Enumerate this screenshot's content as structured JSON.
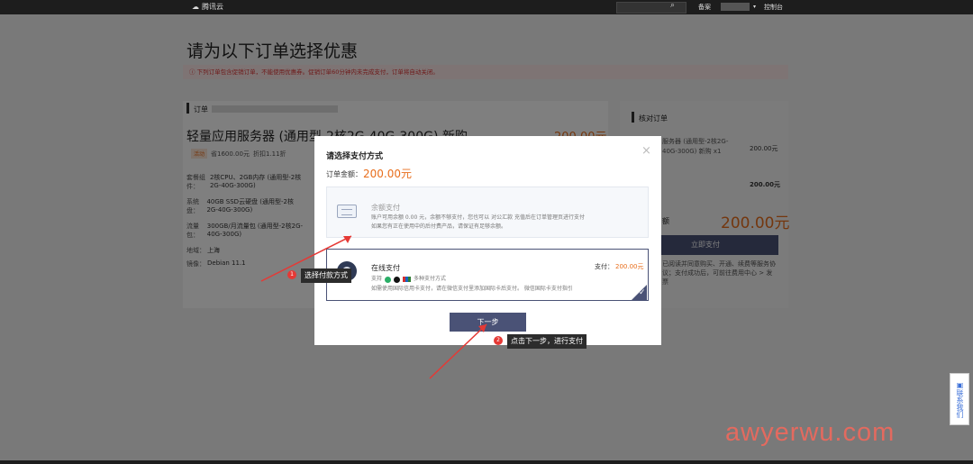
{
  "topbar": {
    "logo": "腾讯云",
    "nav_beian": "备案",
    "nav_console": "控制台"
  },
  "page": {
    "title": "请为以下订单选择优惠",
    "notice": "下列订单包含促销订单，不能使用优惠券。促销订单60分钟内未完成支付，订单将自动关闭。",
    "order_label": "订单",
    "product_name": "轻量应用服务器 (通用型-2核2G-40G-300G) 新购",
    "product_price": "200.00元",
    "tag_activity": "活动",
    "original_price": "省1600.00元",
    "discount": "折扣1.11折",
    "specs": [
      {
        "label": "套餐组件：",
        "value": "2核CPU、2GB内存 (通用型-2核2G-40G-300G)"
      },
      {
        "label": "系统盘：",
        "value": "40GB SSD云硬盘 (通用型-2核2G-40G-300G)"
      },
      {
        "label": "流量包：",
        "value": "300GB/月流量包 (通用型-2核2G-40G-300G)"
      },
      {
        "label": "地域：",
        "value": "上海"
      },
      {
        "label": "镜像：",
        "value": "Debian 11.1"
      }
    ],
    "right_title": "核对订单",
    "right_item_name": "服务器 (通用型-2核2G-40G-300G) 新购 x1",
    "right_item_price": "200.00元",
    "right_subtotal": "200.00元",
    "right_total_label": "额",
    "right_total": "200.00元",
    "buy_button": "立即支付",
    "right_note": "已阅读并同意购买、开通、续费等服务协议；支付成功后，可前往费用中心 > 发票"
  },
  "modal": {
    "title": "请选择支付方式",
    "amount_label": "订单金额：",
    "amount_value": "200.00元",
    "balance_title": "余额支付",
    "balance_desc1": "账户可用余额 0.00 元，余额不够支付，您也可以 对公汇款 充值后在订单管理页进行支付",
    "balance_desc2": "如果您有正在使用中的后付费产品，请保证有足够余额。",
    "online_title": "在线支付",
    "online_pay_label": "支付：",
    "online_pay_value": "200.00元",
    "online_support": "支持",
    "online_multi": "多种支付方式",
    "online_desc": "如需使用国际信用卡支付，请在微信支付里添加国际卡后支付。 微信国际卡支付指引",
    "next_button": "下一步",
    "close": "×"
  },
  "annotations": {
    "badge1": "1",
    "tip1": "选择付款方式",
    "badge2": "2",
    "tip2": "点击下一步，进行支付"
  },
  "contact": "联系我们",
  "watermark": "awyerwu.com",
  "colors": {
    "accent": "#4a5276",
    "price": "#e86e1c",
    "annotation": "#e53935"
  }
}
